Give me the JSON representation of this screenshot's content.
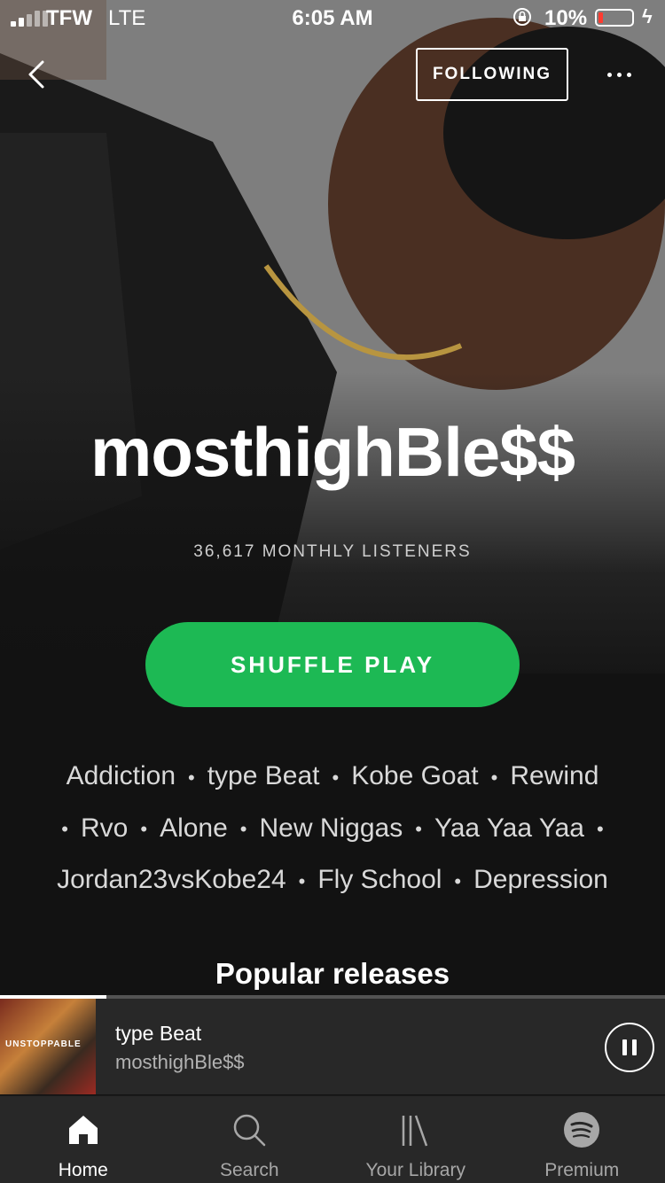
{
  "status_bar": {
    "carrier": "TFW",
    "network": "LTE",
    "time": "6:05 AM",
    "battery_percent": "10%"
  },
  "header": {
    "follow_label": "FOLLOWING"
  },
  "artist": {
    "name": "mosthighBle$$",
    "monthly_listeners": "36,617 MONTHLY LISTENERS"
  },
  "shuffle_label": "SHUFFLE PLAY",
  "popular_tracks": [
    "Addiction",
    "type Beat",
    "Kobe Goat",
    "Rewind",
    "Rvo",
    "Alone",
    "New Niggas",
    "Yaa Yaa Yaa",
    "Jordan23vsKobe24",
    "Fly School",
    "Depression"
  ],
  "section_title": "Popular releases",
  "now_playing": {
    "title": "type Beat",
    "artist": "mosthighBle$$",
    "art_text": "UNSTOPPABLE",
    "progress": 0.16
  },
  "tabs": [
    {
      "label": "Home",
      "icon": "home-icon",
      "active": true
    },
    {
      "label": "Search",
      "icon": "search-icon",
      "active": false
    },
    {
      "label": "Your Library",
      "icon": "library-icon",
      "active": false
    },
    {
      "label": "Premium",
      "icon": "spotify-icon",
      "active": false
    }
  ],
  "colors": {
    "accent": "#1db954",
    "background": "#121212",
    "bar": "#282828"
  }
}
